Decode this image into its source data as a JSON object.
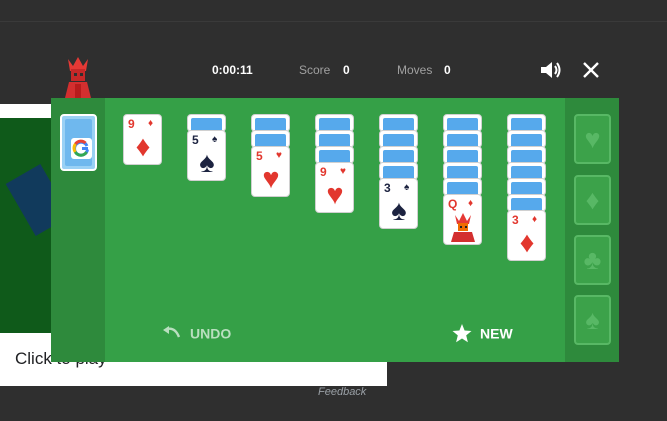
{
  "background": {
    "click_text": "Click to play",
    "feedback": "Feedback"
  },
  "header": {
    "timer": "0:00:11",
    "score_label": "Score",
    "score": "0",
    "moves_label": "Moves",
    "moves": "0"
  },
  "tableau": [
    {
      "rank": "9",
      "suit": "♦",
      "color": "red",
      "hidden": 0
    },
    {
      "rank": "5",
      "suit": "♠",
      "color": "black",
      "hidden": 1
    },
    {
      "rank": "5",
      "suit": "♥",
      "color": "red",
      "hidden": 2
    },
    {
      "rank": "9",
      "suit": "♥",
      "color": "red",
      "hidden": 3
    },
    {
      "rank": "3",
      "suit": "♠",
      "color": "black",
      "hidden": 4
    },
    {
      "rank": "Q",
      "suit": "♦",
      "color": "red",
      "hidden": 5
    },
    {
      "rank": "3",
      "suit": "♦",
      "color": "red",
      "hidden": 6
    }
  ],
  "foundations": [
    {
      "suit": "♥",
      "icon": "heart-icon"
    },
    {
      "suit": "♦",
      "icon": "diamond-icon"
    },
    {
      "suit": "♣",
      "icon": "club-icon"
    },
    {
      "suit": "♠",
      "icon": "spade-icon"
    }
  ],
  "buttons": {
    "undo": "UNDO",
    "new": "NEW"
  },
  "colors": {
    "felt": "#35a047",
    "side": "#2e8a3c",
    "red_suit": "#e2372e",
    "black_suit": "#1c2340",
    "card_back": "#56a9ec"
  }
}
